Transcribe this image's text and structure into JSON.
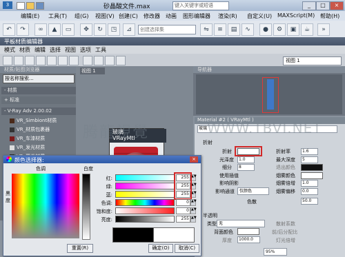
{
  "app": {
    "title": "砂晶酸文件.max",
    "search_placeholder": "键入关键字或短语",
    "menu": [
      "编辑(E)",
      "工具(T)",
      "组(G)",
      "视图(V)",
      "创建(C)",
      "修改器",
      "动画",
      "图形编辑器",
      "渲染(R)",
      "自定义(U)",
      "MAXScript(M)",
      "帮助(H)"
    ],
    "selection_set_placeholder": "创建选择集"
  },
  "slate": {
    "title": "平板材质编辑器",
    "menu": [
      "模式",
      "材质",
      "编辑",
      "选择",
      "视图",
      "选项",
      "工具"
    ],
    "browser_header": "材质/贴图浏览器",
    "browser_search": "按名称搜索...",
    "groups": [
      "- 材质",
      "+ 标准",
      "- V-Ray Adv 2.00.02"
    ],
    "materials": [
      {
        "name": "VR_Simbiont材质",
        "color": "#4a2a1a"
      },
      {
        "name": "VR_材质包裹器",
        "color": "#333333"
      },
      {
        "name": "VR_车漆材质",
        "color": "#7a1a1a"
      },
      {
        "name": "VR_发光材质",
        "color": "#dddddd"
      },
      {
        "name": "VR_覆盖材质",
        "color": "#2a2a2a"
      }
    ],
    "view_tab": "视图 1",
    "node_name": "玻璃",
    "node_type": "VRayMtl",
    "navigator_header": "导航器",
    "view_selector": "视图 1"
  },
  "params": {
    "header": "Material #2 ( VRayMtl )",
    "mat_name": "玻璃",
    "refraction_section": "折射",
    "refract_label": "折射",
    "glossiness_label": "光泽度",
    "glossiness_value": "1.0",
    "subdivs_label": "细分",
    "subdivs_value": "8",
    "use_interp_label": "使用插值",
    "affect_shadows_label": "影响阴影",
    "affect_channels_label": "影响通道",
    "affect_channels_value": "仅颜色",
    "ior_label": "折射率",
    "ior_value": "1.6",
    "max_depth_label": "最大深度",
    "max_depth_value": "5",
    "exit_color_label": "退出颜色",
    "fog_color_label": "烟雾颜色",
    "fog_mult_label": "烟雾倍增",
    "fog_mult_value": "1.0",
    "fog_bias_label": "烟雾偏移",
    "fog_bias_value": "0.0",
    "dispersion_label": "色散",
    "dispersion_abbe_value": "50.0",
    "translucency_section": "半透明",
    "type_label": "类型",
    "type_value": "无",
    "scatter_coeff_label": "散射系数",
    "back_color_label": "背面颜色",
    "fwd_back_label": "前/后分配比",
    "thickness_label": "厚度",
    "thickness_value": "1000.0",
    "light_mult_label": "灯光倍增",
    "zoom": "95%"
  },
  "color_dialog": {
    "title": "颜色选择器:",
    "close": "×",
    "hue_label": "色调",
    "whiteness_label": "白度",
    "blackness_label": "黑度",
    "rows": [
      {
        "label": "红:",
        "value": "255"
      },
      {
        "label": "绿:",
        "value": "255"
      },
      {
        "label": "蓝:",
        "value": "255"
      },
      {
        "label": "色调:",
        "value": "0"
      },
      {
        "label": "饱和度:",
        "value": "0"
      },
      {
        "label": "亮度:",
        "value": "255"
      }
    ],
    "reset_button": "重置(R)",
    "ok_button": "确定(O)",
    "cancel_button": "取消(C)"
  },
  "watermark": {
    "left": "腾龍視覺",
    "right": "WWW.TBVI.NET"
  }
}
